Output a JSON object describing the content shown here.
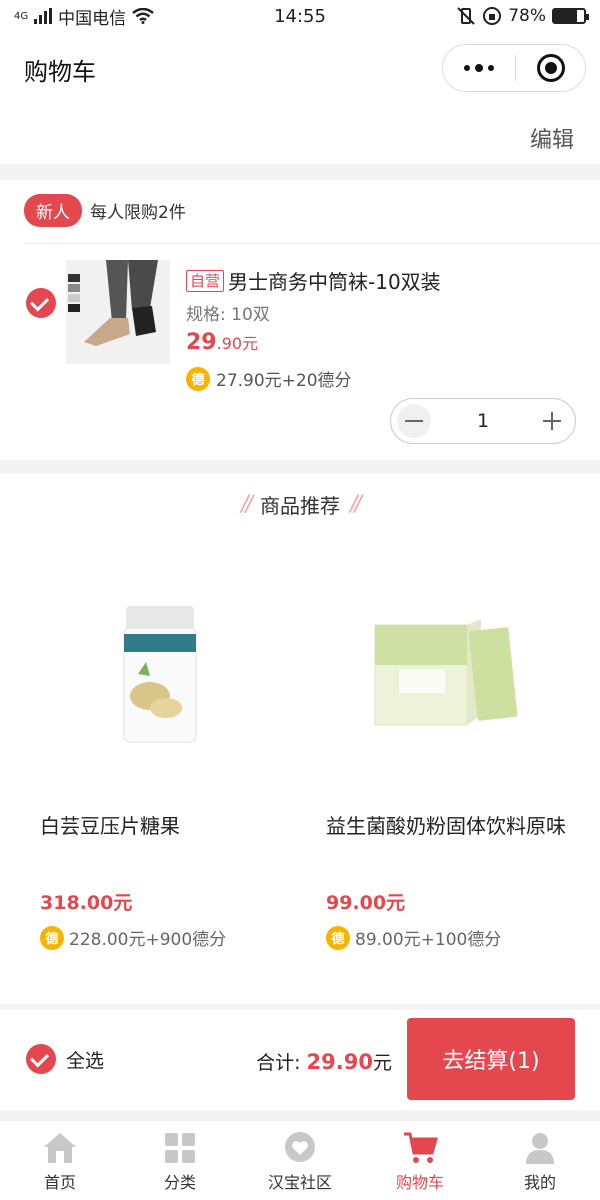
{
  "status": {
    "carrier": "中国电信",
    "network": "4G",
    "time": "14:55",
    "battery": "78%",
    "battery_level": 0.78
  },
  "header": {
    "title": "购物车"
  },
  "edit_label": "编辑",
  "cart": {
    "promo_badge": "新人",
    "promo_text": "每人限购2件",
    "item": {
      "tag": "自营",
      "title": "男士商务中筒袜-10双装",
      "spec": "规格: 10双",
      "price_int": "29",
      "price_dec": ".90元",
      "points": "27.90元+20德分",
      "quantity": "1"
    }
  },
  "recommend": {
    "title": "商品推荐",
    "items": [
      {
        "name": "白芸豆压片糖果",
        "price": "318.00元",
        "points": "228.00元+900德分"
      },
      {
        "name": "益生菌酸奶粉固体饮料原味",
        "price": "99.00元",
        "points": "89.00元+100德分"
      }
    ]
  },
  "coin_glyph": "德",
  "checkout": {
    "select_all": "全选",
    "total_label": "合计:",
    "total_amount": "29.90",
    "total_unit": "元",
    "button": "去结算(1)"
  },
  "tabs": [
    {
      "label": "首页",
      "icon": "home-icon"
    },
    {
      "label": "分类",
      "icon": "category-icon"
    },
    {
      "label": "汉宝社区",
      "icon": "community-icon"
    },
    {
      "label": "购物车",
      "icon": "cart-icon"
    },
    {
      "label": "我的",
      "icon": "profile-icon"
    }
  ],
  "colors": {
    "accent": "#e5474e",
    "coin": "#f5b400"
  }
}
